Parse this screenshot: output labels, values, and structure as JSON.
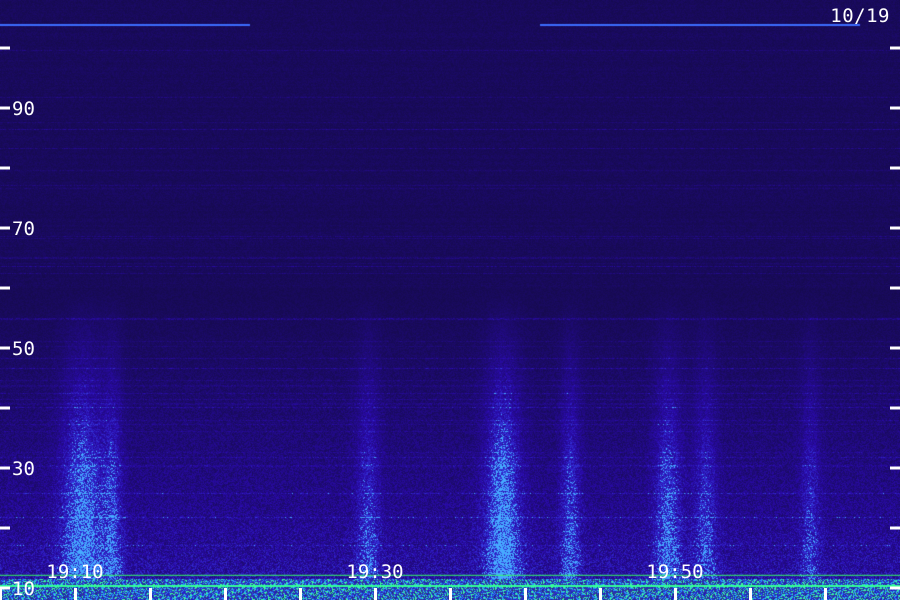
{
  "date_label": "10/19",
  "chart_data": {
    "type": "heatmap",
    "title": "",
    "xlabel": "",
    "ylabel": "",
    "ylim": [
      8,
      108
    ],
    "y_tick_labels": [
      {
        "value": 10,
        "label": "10"
      },
      {
        "value": 30,
        "label": "30"
      },
      {
        "value": 50,
        "label": "50"
      },
      {
        "value": 70,
        "label": "70"
      },
      {
        "value": 90,
        "label": "90"
      }
    ],
    "y_ticks_unlabeled": [
      20,
      40,
      60,
      80,
      100
    ],
    "x_tick_labels": [
      {
        "value": "19:10",
        "label": "19:10"
      },
      {
        "value": "19:30",
        "label": "19:30"
      },
      {
        "value": "19:50",
        "label": "19:50"
      }
    ],
    "xlim": [
      "19:05",
      "20:05"
    ],
    "x_ticks_minutes": [
      5,
      10,
      15,
      20,
      25,
      30,
      35,
      40,
      45,
      50,
      55,
      60
    ],
    "colors": {
      "background": "#1a0a4e",
      "low_band": "#3333cc",
      "high_intensity": "#33ff99",
      "mid_intensity": "#4488ff",
      "axis": "#ffffff"
    }
  }
}
